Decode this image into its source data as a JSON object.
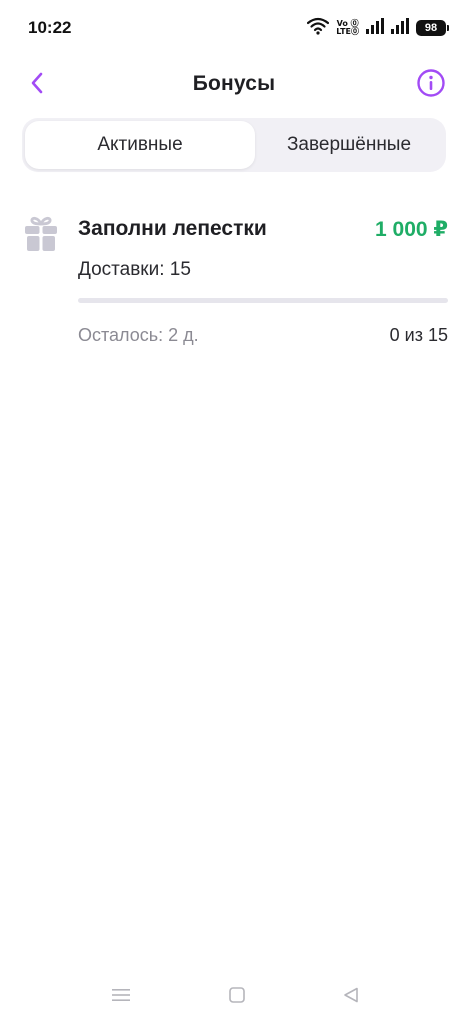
{
  "status_bar": {
    "time": "10:22",
    "volte_top": "Vo ⓪",
    "volte_bottom": "LTE⓪",
    "battery": "98"
  },
  "header": {
    "title": "Бонусы",
    "back_icon": "chevron-left-icon",
    "info_icon": "info-circle-icon",
    "accent_color": "#a24bf5"
  },
  "tabs": [
    {
      "label": "Активные",
      "active": true
    },
    {
      "label": "Завершённые",
      "active": false
    }
  ],
  "bonus": {
    "icon": "gift-icon",
    "title": "Заполни лепестки",
    "amount": "1 000 ₽",
    "amount_color": "#1fad66",
    "deliveries": "Доставки: 15",
    "progress_fraction": 0,
    "remaining": "Осталось: 2 д.",
    "progress_text": "0 из 15"
  },
  "nav_bar": {
    "menu_icon": "menu-icon",
    "home_icon": "home-square-icon",
    "back_icon": "back-triangle-icon"
  }
}
